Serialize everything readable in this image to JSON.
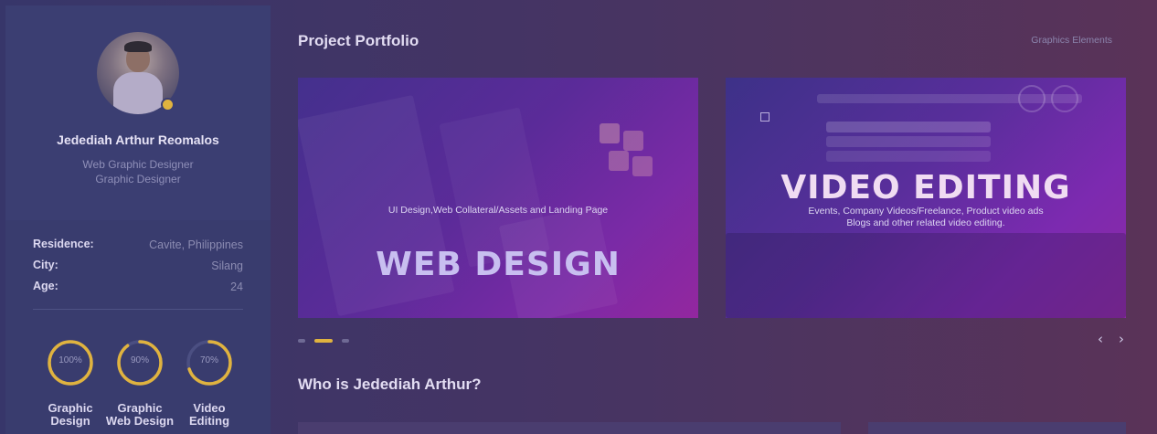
{
  "profile": {
    "name": "Jedediah Arthur Reomalos",
    "roles": [
      "Web Graphic Designer",
      "Graphic Designer"
    ],
    "status_color": "#e0b33f"
  },
  "info": [
    {
      "label": "Residence:",
      "value": "Cavite, Philippines"
    },
    {
      "label": "City:",
      "value": "Silang"
    },
    {
      "label": "Age:",
      "value": "24"
    }
  ],
  "skills": [
    {
      "percent": 100,
      "label": "100%",
      "name_lines": [
        "Graphic",
        "Design"
      ]
    },
    {
      "percent": 90,
      "label": "90%",
      "name_lines": [
        "Graphic",
        "Web Design"
      ]
    },
    {
      "percent": 70,
      "label": "70%",
      "name_lines": [
        "Video",
        "Editing"
      ]
    }
  ],
  "main": {
    "portfolio_title": "Project Portfolio",
    "top_link": "Graphics Elements",
    "about_title": "Who is Jedediah Arthur?"
  },
  "cards": [
    {
      "title": "WEB DESIGN",
      "subtitle_lines": [
        "UI Design,Web Collateral/Assets and Landing Page"
      ]
    },
    {
      "title": "VIDEO EDITING",
      "subtitle_lines": [
        "Events, Company Videos/Freelance, Product video ads",
        "Blogs and other related video editing."
      ]
    }
  ],
  "carousel": {
    "active_index": 1,
    "dot_count": 3,
    "prev_icon": "chevron-left-icon",
    "next_icon": "chevron-right-icon"
  },
  "colors": {
    "accent": "#e0b33f",
    "sidebar": "#393c6e"
  }
}
